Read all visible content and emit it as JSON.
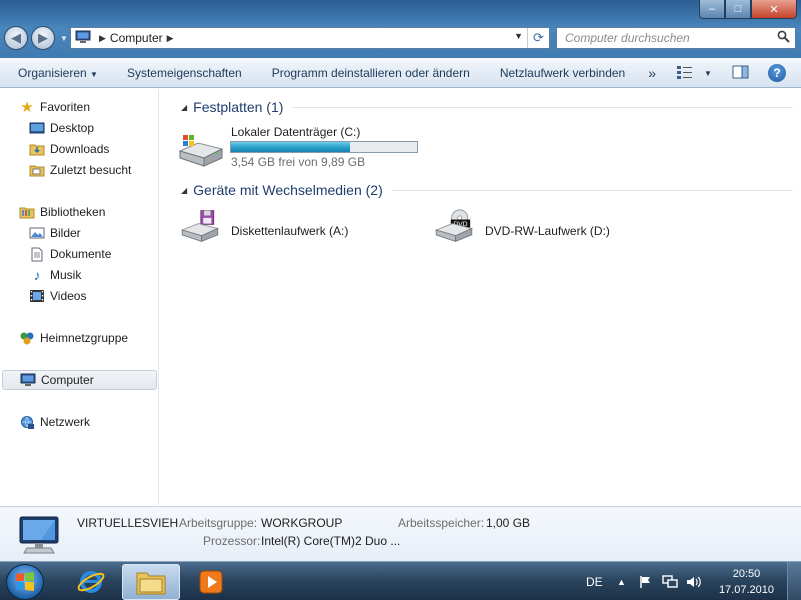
{
  "window": {
    "minimize_label": "–",
    "maximize_label": "□",
    "close_label": "✕"
  },
  "address": {
    "location": "Computer",
    "search_placeholder": "Computer durchsuchen"
  },
  "toolbar": {
    "organize": "Organisieren",
    "system_properties": "Systemeigenschaften",
    "uninstall": "Programm deinstallieren oder ändern",
    "map_drive": "Netzlaufwerk verbinden",
    "more": "»",
    "help": "?"
  },
  "sidebar": {
    "favorites": "Favoriten",
    "desktop": "Desktop",
    "downloads": "Downloads",
    "recent": "Zuletzt besucht",
    "libraries": "Bibliotheken",
    "pictures": "Bilder",
    "documents": "Dokumente",
    "music": "Musik",
    "videos": "Videos",
    "homegroup": "Heimnetzgruppe",
    "computer": "Computer",
    "network": "Netzwerk"
  },
  "groups": {
    "hard_disks": "Festplatten (1)",
    "removable": "Geräte mit Wechselmedien (2)"
  },
  "drives": {
    "c_name": "Lokaler Datenträger (C:)",
    "c_free": "3,54 GB frei von 9,89 GB",
    "c_used_fraction": 0.642,
    "a_name": "Diskettenlaufwerk (A:)",
    "d_name": "DVD-RW-Laufwerk (D:)",
    "d_icon_text": "DVD"
  },
  "details": {
    "computer_name": "VIRTUELLESVIEH",
    "workgroup_label": "Arbeitsgruppe:",
    "workgroup_value": "WORKGROUP",
    "memory_label": "Arbeitsspeicher:",
    "memory_value": "1,00 GB",
    "cpu_label": "Prozessor:",
    "cpu_value": "Intel(R) Core(TM)2 Duo ..."
  },
  "taskbar": {
    "language": "DE",
    "time": "20:50",
    "date": "17.07.2010"
  },
  "colors": {
    "accent": "#1e3d6e",
    "progress": "#2aa2cc"
  }
}
